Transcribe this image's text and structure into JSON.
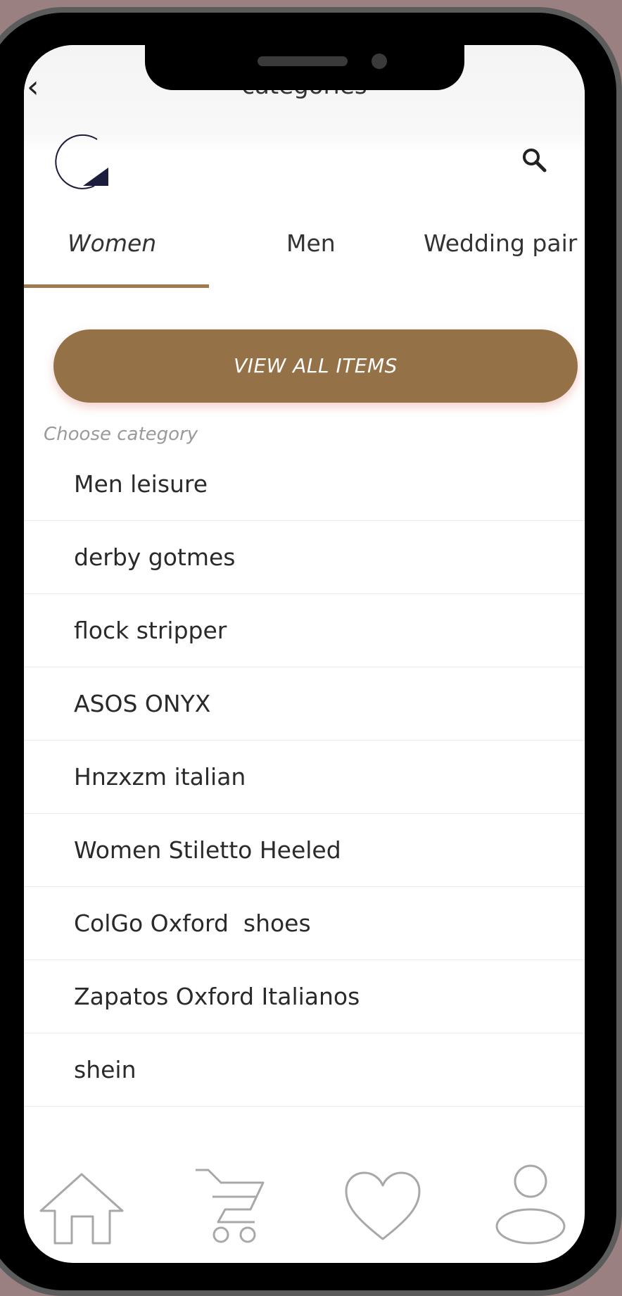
{
  "header": {
    "back_icon": "chevron-left-icon",
    "title": "categories"
  },
  "brand": {
    "logo_icon": "brand-logo-icon",
    "search_icon": "search-icon"
  },
  "tabs": [
    {
      "label": "Women",
      "active": true
    },
    {
      "label": "Men",
      "active": false
    },
    {
      "label": "Wedding pair",
      "active": false
    }
  ],
  "accent_color": "#947147",
  "view_all_label": "VIEW ALL ITEMS",
  "choose_category_label": "Choose category",
  "categories": [
    "Men leisure",
    "derby gotmes",
    "flock stripper",
    "ASOS ONYX",
    "Hnzxzm italian",
    "Women Stiletto Heeled",
    "ColGo Oxford  shoes",
    "Zapatos Oxford Italianos",
    "shein"
  ],
  "bottom_nav": [
    {
      "icon": "home-icon"
    },
    {
      "icon": "cart-icon"
    },
    {
      "icon": "heart-icon"
    },
    {
      "icon": "profile-icon"
    }
  ]
}
